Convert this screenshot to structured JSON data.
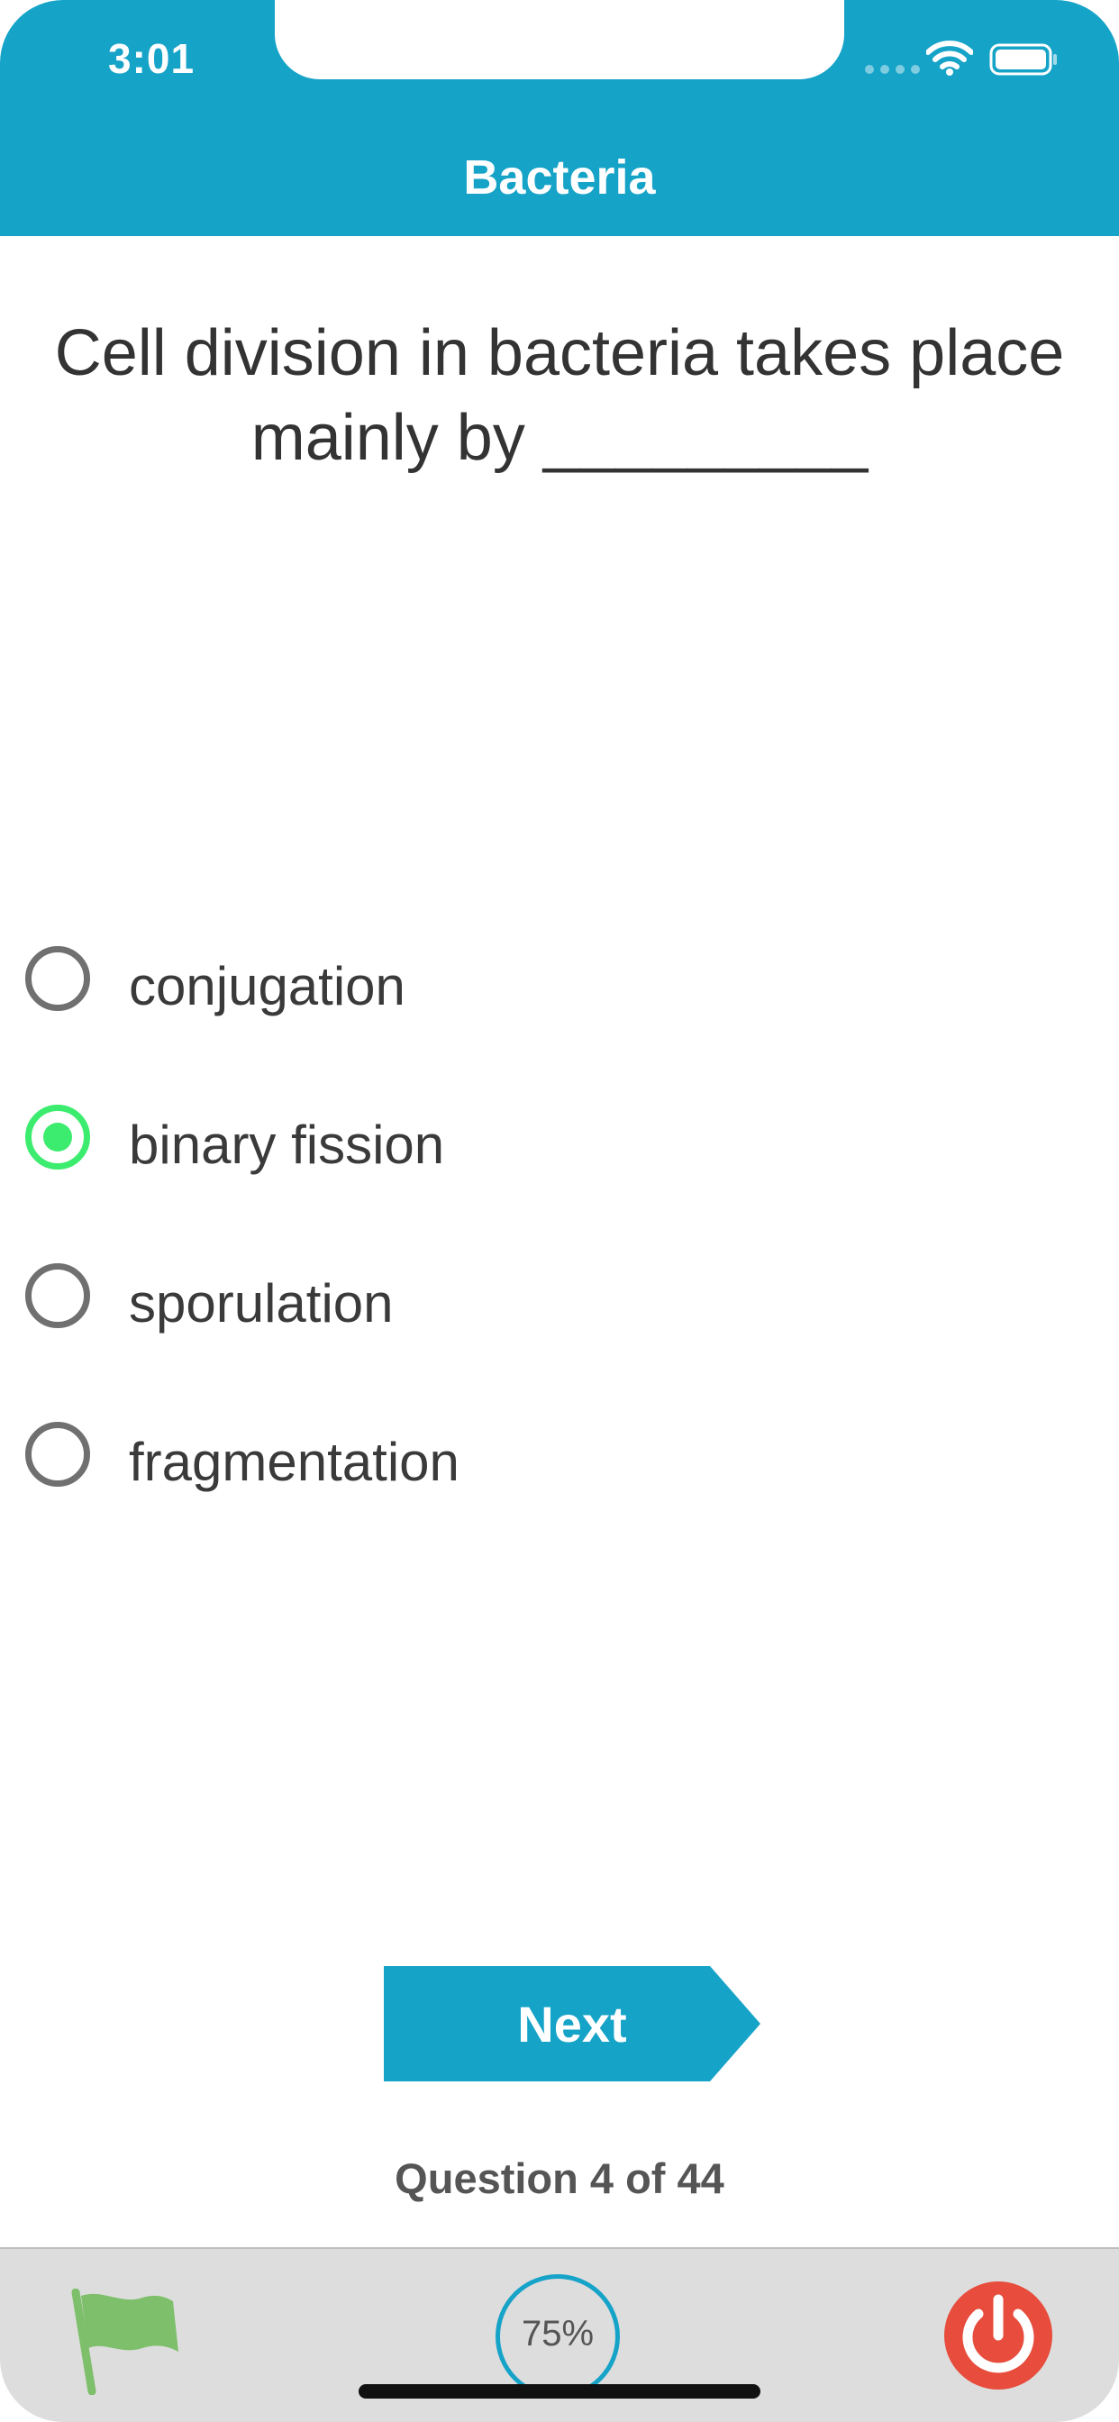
{
  "status_bar": {
    "time": "3:01"
  },
  "nav": {
    "title": "Bacteria"
  },
  "question": {
    "text": "Cell division in bacteria takes place mainly by _________"
  },
  "options": [
    {
      "label": "conjugation",
      "selected": false
    },
    {
      "label": "binary fission",
      "selected": true
    },
    {
      "label": "sporulation",
      "selected": false
    },
    {
      "label": "fragmentation",
      "selected": false
    }
  ],
  "actions": {
    "next_label": "Next"
  },
  "progress": {
    "text": "Question 4 of 44"
  },
  "tabbar": {
    "percent": "75%",
    "icons": [
      "flag-icon",
      "progress-ring",
      "power-icon"
    ]
  },
  "colors": {
    "accent": "#16a3c8",
    "selected": "#3cec6e",
    "power": "#e74c3c",
    "flag": "#7dbf6a"
  }
}
